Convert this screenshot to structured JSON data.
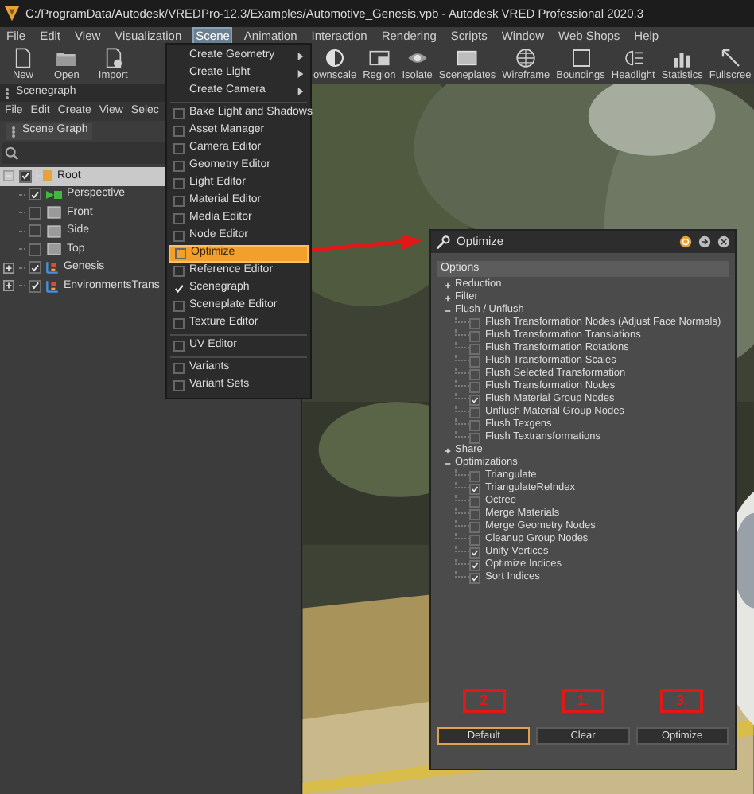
{
  "window": {
    "title": "C:/ProgramData/Autodesk/VREDPro-12.3/Examples/Automotive_Genesis.vpb - Autodesk VRED Professional 2020.3"
  },
  "menu_bar": [
    {
      "label": "File",
      "selected": false
    },
    {
      "label": "Edit",
      "selected": false
    },
    {
      "label": "View",
      "selected": false
    },
    {
      "label": "Visualization",
      "selected": false
    },
    {
      "label": "Scene",
      "selected": true
    },
    {
      "label": "Animation",
      "selected": false
    },
    {
      "label": "Interaction",
      "selected": false
    },
    {
      "label": "Rendering",
      "selected": false
    },
    {
      "label": "Scripts",
      "selected": false
    },
    {
      "label": "Window",
      "selected": false
    },
    {
      "label": "Web Shops",
      "selected": false
    },
    {
      "label": "Help",
      "selected": false
    }
  ],
  "toolbar": {
    "left": [
      "New",
      "Open",
      "Import"
    ],
    "right": [
      "ownscale",
      "Region",
      "Isolate",
      "Sceneplates",
      "Wireframe",
      "Boundings",
      "Headlight",
      "Statistics",
      "Fullscree"
    ]
  },
  "scene_menu": [
    {
      "kind": "submenu",
      "label": "Create Geometry",
      "selected": false
    },
    {
      "kind": "submenu",
      "label": "Create Light",
      "selected": false
    },
    {
      "kind": "submenu",
      "label": "Create Camera",
      "selected": false
    },
    {
      "kind": "separator"
    },
    {
      "kind": "check",
      "label": "Bake Light and Shadows",
      "checked": false,
      "selected": false
    },
    {
      "kind": "check",
      "label": "Asset Manager",
      "checked": false,
      "selected": false
    },
    {
      "kind": "check",
      "label": "Camera Editor",
      "checked": false,
      "selected": false
    },
    {
      "kind": "check",
      "label": "Geometry Editor",
      "checked": false,
      "selected": false
    },
    {
      "kind": "check",
      "label": "Light Editor",
      "checked": false,
      "selected": false
    },
    {
      "kind": "check",
      "label": "Material Editor",
      "checked": false,
      "selected": false
    },
    {
      "kind": "check",
      "label": "Media Editor",
      "checked": false,
      "selected": false
    },
    {
      "kind": "check",
      "label": "Node Editor",
      "checked": false,
      "selected": false
    },
    {
      "kind": "check",
      "label": "Optimize",
      "checked": false,
      "selected": true
    },
    {
      "kind": "check",
      "label": "Reference Editor",
      "checked": false,
      "selected": false
    },
    {
      "kind": "check",
      "label": "Scenegraph",
      "checked": true,
      "selected": false
    },
    {
      "kind": "check",
      "label": "Sceneplate Editor",
      "checked": false,
      "selected": false
    },
    {
      "kind": "check",
      "label": "Texture Editor",
      "checked": false,
      "selected": false
    },
    {
      "kind": "separator"
    },
    {
      "kind": "check",
      "label": "UV Editor",
      "checked": false,
      "selected": false
    },
    {
      "kind": "separator"
    },
    {
      "kind": "check",
      "label": "Variants",
      "checked": false,
      "selected": false
    },
    {
      "kind": "check",
      "label": "Variant Sets",
      "checked": false,
      "selected": false
    }
  ],
  "scenegraph_panel": {
    "title": "Scenegraph",
    "menu": [
      "File",
      "Edit",
      "Create",
      "View",
      "Selec"
    ],
    "tab": "Scene Graph",
    "tree": [
      {
        "label": "Root",
        "kind": "root",
        "checked": true,
        "selected": true,
        "expanded": true,
        "children": [
          {
            "label": "Perspective",
            "kind": "perspective",
            "checked": true,
            "selected": false
          },
          {
            "label": "Front",
            "kind": "view",
            "checked": false,
            "selected": false
          },
          {
            "label": "Side",
            "kind": "view",
            "checked": false,
            "selected": false
          },
          {
            "label": "Top",
            "kind": "view",
            "checked": false,
            "selected": false
          },
          {
            "label": "Genesis",
            "kind": "transform",
            "checked": true,
            "selected": false,
            "expanded": false
          },
          {
            "label": "EnvironmentsTrans",
            "kind": "transform",
            "checked": true,
            "selected": false,
            "expanded": false
          }
        ]
      }
    ]
  },
  "optimize_dialog": {
    "title": "Optimize",
    "header": "Options",
    "tree": [
      {
        "label": "Reduction",
        "expanded": false
      },
      {
        "label": "Filter",
        "expanded": false
      },
      {
        "label": "Flush / Unflush",
        "expanded": true,
        "children": [
          {
            "label": "Flush Transformation Nodes (Adjust Face Normals)",
            "checked": false
          },
          {
            "label": "Flush Transformation Translations",
            "checked": false
          },
          {
            "label": "Flush Transformation Rotations",
            "checked": false
          },
          {
            "label": "Flush Transformation Scales",
            "checked": false
          },
          {
            "label": "Flush Selected Transformation",
            "checked": false
          },
          {
            "label": "Flush Transformation Nodes",
            "checked": false
          },
          {
            "label": "Flush Material Group Nodes",
            "checked": true
          },
          {
            "label": "Unflush Material Group Nodes",
            "checked": false
          },
          {
            "label": "Flush Texgens",
            "checked": false
          },
          {
            "label": "Flush Textransformations",
            "checked": false
          }
        ]
      },
      {
        "label": "Share",
        "expanded": false
      },
      {
        "label": "Optimizations",
        "expanded": true,
        "children": [
          {
            "label": "Triangulate",
            "checked": false
          },
          {
            "label": "TriangulateReIndex",
            "checked": true
          },
          {
            "label": "Octree",
            "checked": false
          },
          {
            "label": "Merge Materials",
            "checked": false
          },
          {
            "label": "Merge Geometry Nodes",
            "checked": false
          },
          {
            "label": "Cleanup Group Nodes",
            "checked": false
          },
          {
            "label": "Unify Vertices",
            "checked": true
          },
          {
            "label": "Optimize Indices",
            "checked": true
          },
          {
            "label": "Sort Indices",
            "checked": true
          }
        ]
      }
    ],
    "buttons": [
      {
        "label": "Default",
        "focused": true,
        "callout": "2"
      },
      {
        "label": "Clear",
        "focused": false,
        "callout": "1."
      },
      {
        "label": "Optimize",
        "focused": false,
        "callout": "3."
      }
    ]
  }
}
